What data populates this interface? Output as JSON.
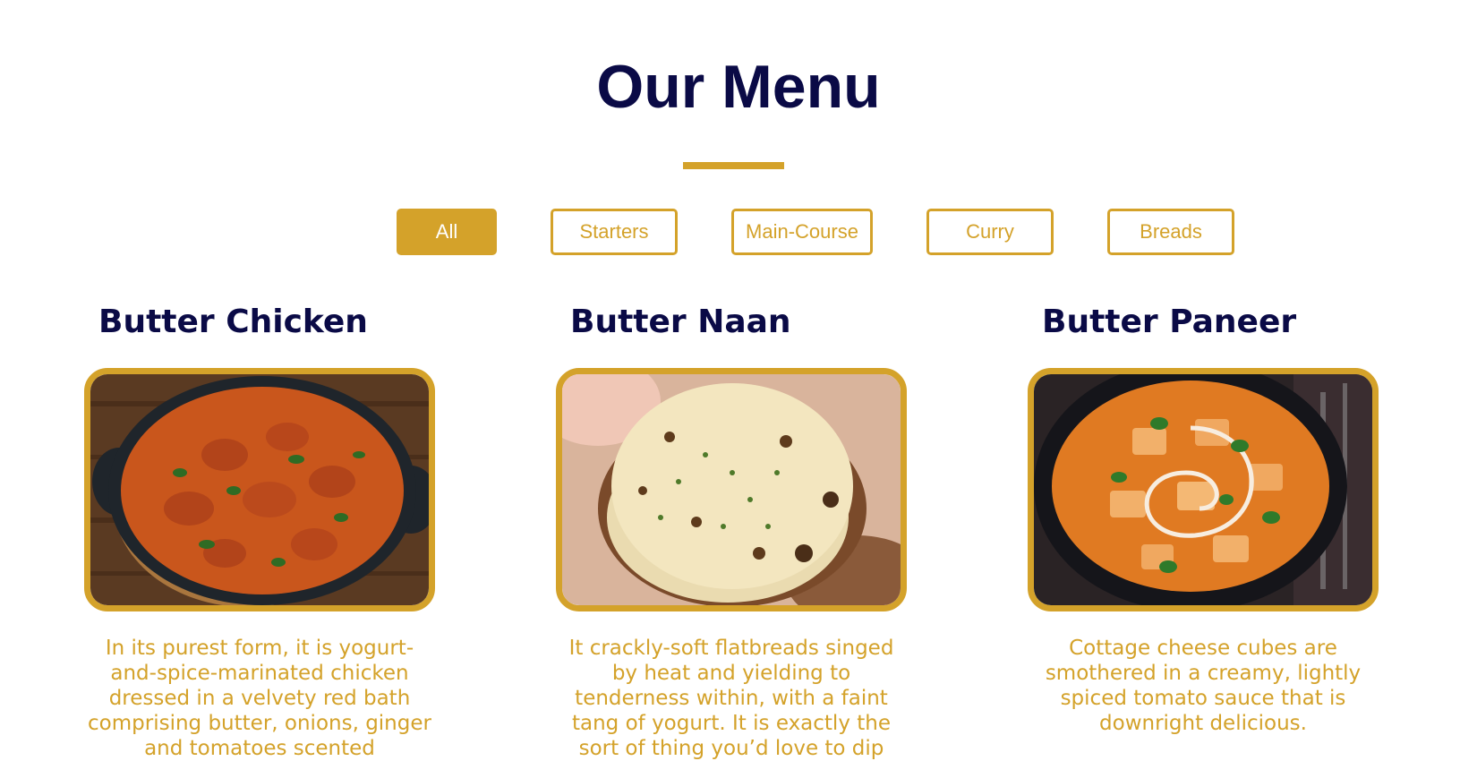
{
  "header": {
    "title": "Our Menu"
  },
  "filters": {
    "all": "All",
    "starters": "Starters",
    "main_course": "Main-Course",
    "curry": "Curry",
    "breads": "Breads",
    "active": "All"
  },
  "colors": {
    "accent": "#d4a22a",
    "heading": "#0a0a46",
    "background": "#ffffff"
  },
  "items": [
    {
      "name": "Butter Chicken",
      "image": "butter-chicken-photo",
      "description": "In its purest form, it is yogurt-and-spice-marinated chicken dressed in a velvety red bath comprising butter, onions, ginger and tomatoes scented"
    },
    {
      "name": "Butter Naan",
      "image": "butter-naan-photo",
      "description": "It crackly-soft flatbreads singed by heat and yielding to tenderness within, with a faint tang of yogurt. It is exactly the sort of thing you’d love to dip"
    },
    {
      "name": "Butter Paneer",
      "image": "butter-paneer-photo",
      "description": "Cottage cheese cubes are smothered in a creamy, lightly spiced tomato sauce that is downright delicious."
    }
  ]
}
